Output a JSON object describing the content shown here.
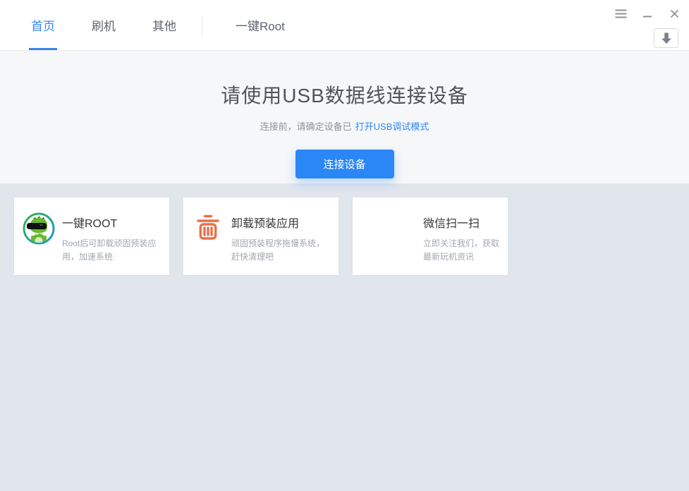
{
  "nav": {
    "tabs": [
      {
        "label": "首页",
        "active": true
      },
      {
        "label": "刷机",
        "active": false
      },
      {
        "label": "其他",
        "active": false
      },
      {
        "label": "一键Root",
        "active": false
      }
    ]
  },
  "window_controls": {
    "menu_icon": "hamburger-menu",
    "minimize_icon": "minimize",
    "close_icon": "close",
    "download_icon": "download-arrow"
  },
  "hero": {
    "title": "请使用USB数据线连接设备",
    "subtitle": "连接前，请确定设备已",
    "subtitle_link": "打开USB调试模式",
    "connect_button": "连接设备"
  },
  "cards": [
    {
      "icon": "mascot-root-icon",
      "title": "一键ROOT",
      "desc_lines": [
        "Root后可卸载顽固预装应",
        "用，加速系统"
      ]
    },
    {
      "icon": "trash-icon",
      "title": "卸载预装应用",
      "desc_lines": [
        "顽固预装程序拖慢系统，",
        "赶快清理吧"
      ]
    },
    {
      "icon": "qr-code-placeholder",
      "title": "微信扫一扫",
      "desc_lines": [
        "立即关注我们，获取",
        "最新玩机资讯"
      ]
    }
  ],
  "colors": {
    "accent_blue": "#2f88f6",
    "button_blue": "#2b87f6",
    "tab_underline": "#3a86e8",
    "hero_bg": "#f6f7f9",
    "page_bg": "#e1e5ec",
    "trash_orange": "#e7714a",
    "mascot_green": "#68b92e",
    "ring_green": "#3cb44b",
    "ring_blue": "#2196d6"
  }
}
